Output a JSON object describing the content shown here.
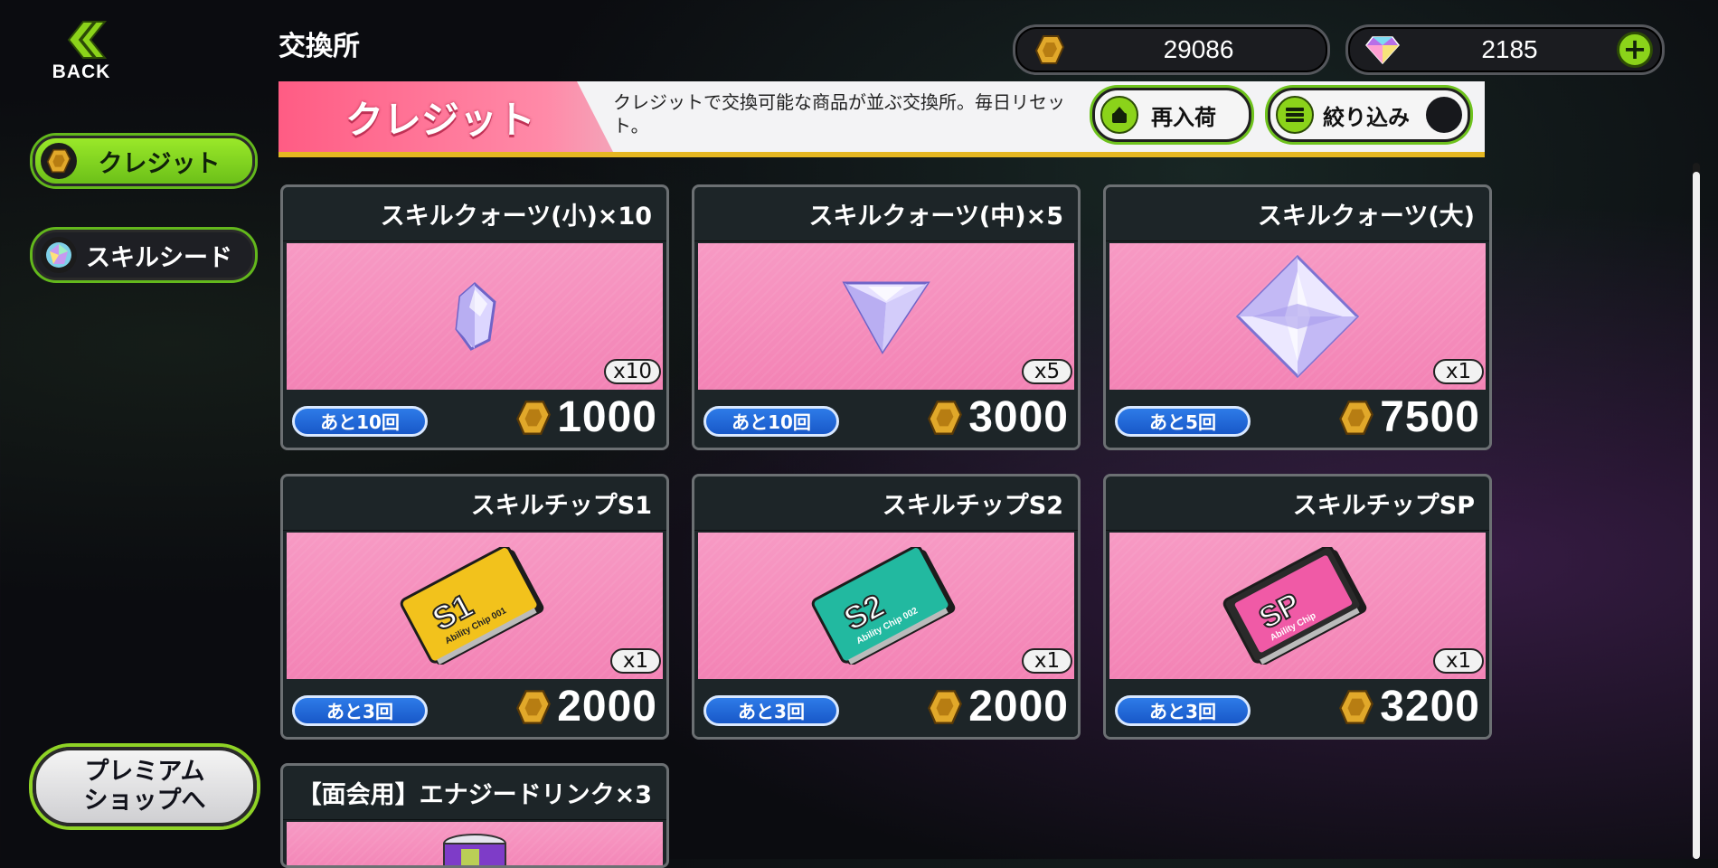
{
  "back_label": "BACK",
  "page_title": "交換所",
  "currencies": {
    "credit": "29086",
    "gem": "2185"
  },
  "sidebar": [
    {
      "label": "クレジット",
      "active": true
    },
    {
      "label": "スキルシード",
      "active": false
    }
  ],
  "premium_shop": {
    "line1": "プレミアム",
    "line2": "ショップへ"
  },
  "banner": {
    "category": "クレジット",
    "description": "クレジットで交換可能な商品が並ぶ交換所。毎日リセット。",
    "restock": "再入荷",
    "filter": "絞り込み"
  },
  "items": [
    {
      "name": "スキルクォーツ(小)×10",
      "qty": "x10",
      "remaining": "あと10回",
      "price": "1000",
      "icon": "small-quartz-icon"
    },
    {
      "name": "スキルクォーツ(中)×5",
      "qty": "x5",
      "remaining": "あと10回",
      "price": "3000",
      "icon": "medium-quartz-icon"
    },
    {
      "name": "スキルクォーツ(大)",
      "qty": "x1",
      "remaining": "あと5回",
      "price": "7500",
      "icon": "large-quartz-icon"
    },
    {
      "name": "スキルチップS1",
      "qty": "x1",
      "remaining": "あと3回",
      "price": "2000",
      "icon": "skill-chip-s1-icon"
    },
    {
      "name": "スキルチップS2",
      "qty": "x1",
      "remaining": "あと3回",
      "price": "2000",
      "icon": "skill-chip-s2-icon"
    },
    {
      "name": "スキルチップSP",
      "qty": "x1",
      "remaining": "あと3回",
      "price": "3200",
      "icon": "skill-chip-sp-icon"
    },
    {
      "name": "【面会用】エナジードリンク×3",
      "icon": "energy-drink-icon"
    }
  ],
  "chips": {
    "s1": {
      "code": "S1",
      "sub": "Ability Chip 001",
      "color": "#f2c21c"
    },
    "s2": {
      "code": "S2",
      "sub": "Ability Chip 002",
      "color": "#22b9a0"
    },
    "sp": {
      "code": "SP",
      "sub": "Ability Chip",
      "color": "#f05aa6"
    }
  },
  "colors": {
    "accent_green": "#8bd31a",
    "card_pink": "#f58bbb",
    "remain_blue": "#1f64d6",
    "banner_pink": "#ff6a90"
  }
}
